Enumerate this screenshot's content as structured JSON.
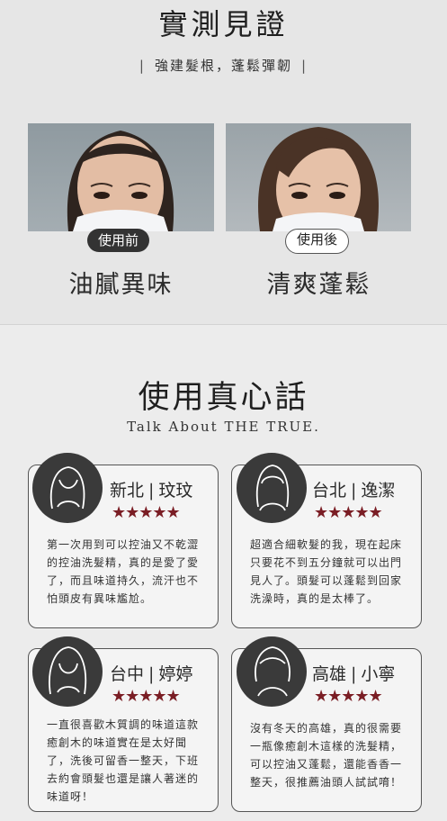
{
  "header": {
    "title": "實測見證",
    "subtitle_bar_left": "|",
    "subtitle": "強建髮根，蓬鬆彈韌",
    "subtitle_bar_right": "|"
  },
  "comparison": {
    "before_label": "使用前",
    "after_label": "使用後",
    "before_result": "油膩異味",
    "after_result": "清爽蓬鬆"
  },
  "testimonials": {
    "title": "使用真心話",
    "subtitle": "Talk About THE TRUE.",
    "star_color": "#7a1d24",
    "cards": [
      {
        "city": "新北",
        "sep": "|",
        "name": "玟玟",
        "stars": "★★★★★",
        "rating": 5,
        "text": "第一次用到可以控油又不乾澀的控油洗髮精，真的是愛了愛了，而且味道持久，流汗也不怕頭皮有異味尷尬。"
      },
      {
        "city": "台北",
        "sep": "|",
        "name": "逸潔",
        "stars": "★★★★★",
        "rating": 5,
        "text": "超適合細軟髮的我，現在起床只要花不到五分鐘就可以出門見人了。頭髮可以蓬鬆到回家洗澡時，真的是太棒了。"
      },
      {
        "city": "台中",
        "sep": "|",
        "name": "婷婷",
        "stars": "★★★★★",
        "rating": 5,
        "text": "一直很喜歡木質調的味道這款癒創木的味道實在是太好聞了，洗後可留香一整天，下班去約會頭髮也還是讓人著迷的味道呀！"
      },
      {
        "city": "高雄",
        "sep": "|",
        "name": "小寧",
        "stars": "★★★★★",
        "rating": 5,
        "text": "沒有冬天的高雄，真的很需要一瓶像癒創木這樣的洗髮精，可以控油又蓬鬆，還能香香一整天，很推薦油頭人試試唷！"
      }
    ]
  }
}
